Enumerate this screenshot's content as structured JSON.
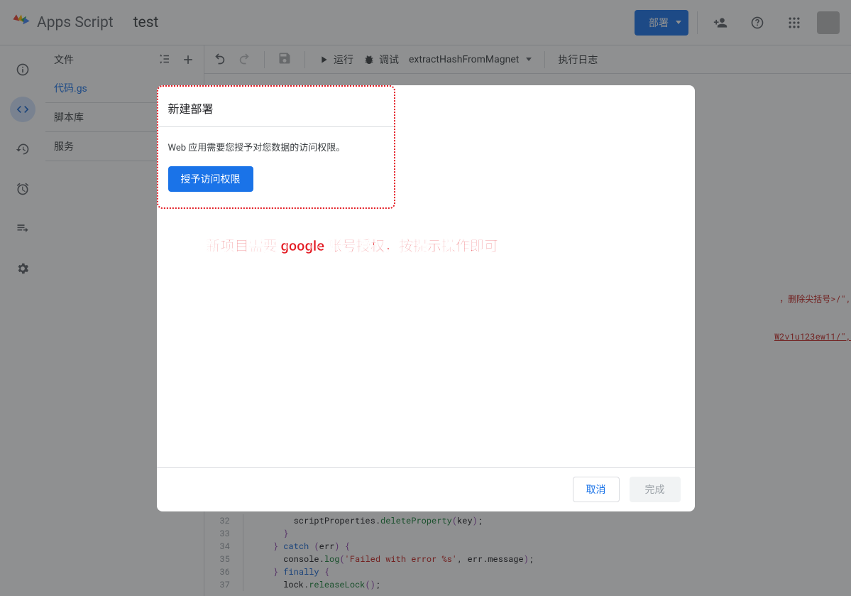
{
  "header": {
    "app_name": "Apps Script",
    "project_name": "test",
    "deploy_label": "部署"
  },
  "sidebar": {
    "files_label": "文件",
    "file_item": "代码.gs",
    "libs_label": "脚本库",
    "services_label": "服务"
  },
  "toolbar": {
    "run_label": "运行",
    "debug_label": "调试",
    "func_name": "extractHashFromMagnet",
    "log_label": "执行日志"
  },
  "code": {
    "lines": [
      {
        "n": 32,
        "html": "    scriptProperties.<span class='tok-prop'>deleteProperty</span><span class='tok-par'>(</span>key<span class='tok-par'>)</span>;"
      },
      {
        "n": 33,
        "html": "  <span class='tok-par'>}</span>"
      },
      {
        "n": 34,
        "html": "<span class='tok-par'>}</span> <span class='tok-kw'>catch</span> <span class='tok-par'>(</span>err<span class='tok-par'>)</span> <span class='tok-par'>{</span>"
      },
      {
        "n": 35,
        "html": "  console.<span class='tok-prop'>log</span><span class='tok-par'>(</span><span class='tok-str'>'Failed with error %s'</span>, err.message<span class='tok-par'>)</span>;"
      },
      {
        "n": 36,
        "html": "<span class='tok-par'>}</span> <span class='tok-kw'>finally</span> <span class='tok-par'>{</span>"
      },
      {
        "n": 37,
        "html": "  lock.<span class='tok-prop'>releaseLock</span><span class='tok-par'>()</span>;"
      }
    ],
    "peek1": "，删除尖括号>/\",",
    "peek2": "W2v1u123ew11/\","
  },
  "dialog": {
    "title": "新建部署",
    "message": "Web 应用需要您授予对您数据的访问权限。",
    "auth_btn": "授予访问权限",
    "annotation": "新项目需要 google 账号授权，按提示操作即可",
    "cancel": "取消",
    "done": "完成"
  }
}
